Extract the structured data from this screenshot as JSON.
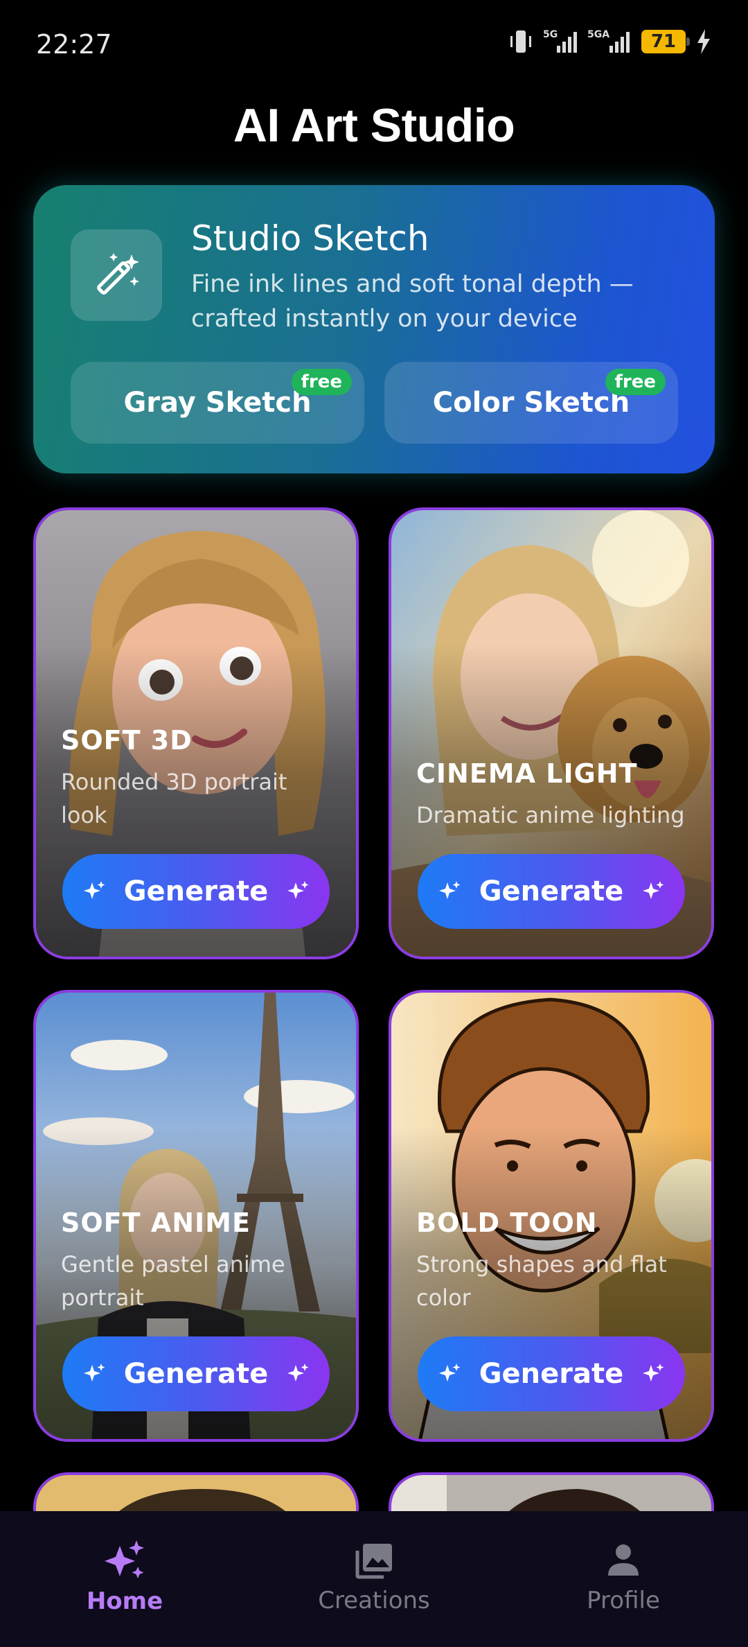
{
  "status": {
    "time": "22:27",
    "battery": "71",
    "net1": "5G",
    "net2": "5GA"
  },
  "header": {
    "title": "AI Art Studio"
  },
  "banner": {
    "title": "Studio Sketch",
    "subtitle": "Fine ink lines and soft tonal depth — crafted instantly on your device",
    "buttons": [
      {
        "label": "Gray Sketch",
        "badge": "free"
      },
      {
        "label": "Color Sketch",
        "badge": "free"
      }
    ]
  },
  "cards": [
    {
      "title": "SOFT 3D",
      "desc": "Rounded 3D portrait look",
      "button": "Generate"
    },
    {
      "title": "CINEMA LIGHT",
      "desc": "Dramatic anime lighting",
      "button": "Generate"
    },
    {
      "title": "SOFT ANIME",
      "desc": "Gentle pastel anime portrait",
      "button": "Generate"
    },
    {
      "title": "BOLD TOON",
      "desc": "Strong shapes and flat color",
      "button": "Generate"
    }
  ],
  "nav": [
    {
      "label": "Home",
      "icon": "sparkles-icon",
      "active": true
    },
    {
      "label": "Creations",
      "icon": "gallery-icon",
      "active": false
    },
    {
      "label": "Profile",
      "icon": "person-icon",
      "active": false
    }
  ],
  "colors": {
    "accent": "#8a3de0",
    "active_nav": "#b77cf5",
    "badge": "#1fb45a"
  }
}
